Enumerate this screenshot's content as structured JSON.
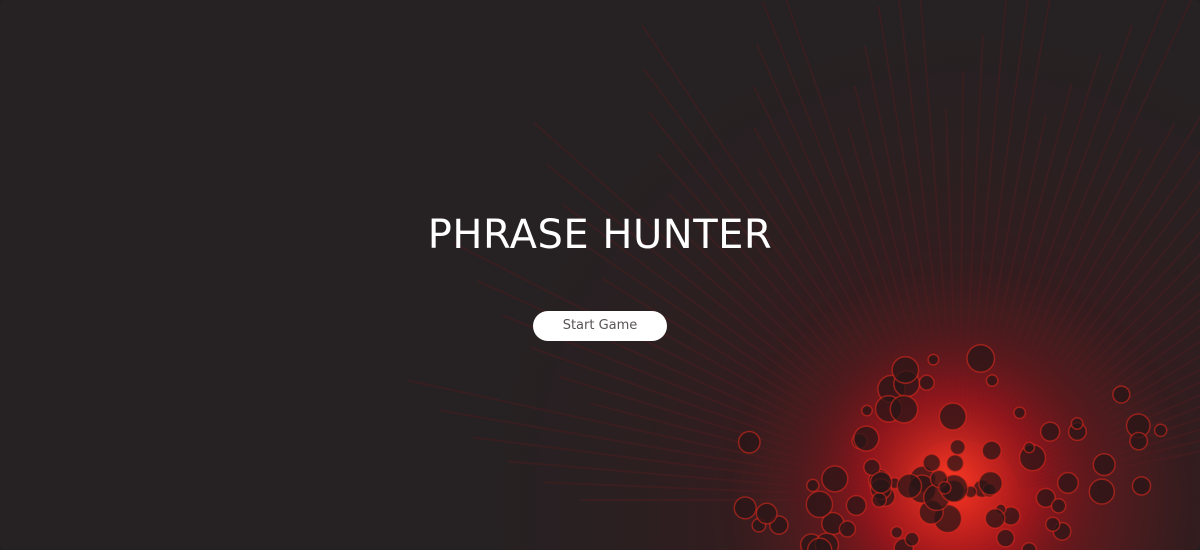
{
  "game": {
    "title": "PHRASE HUNTER",
    "start_button_label": "Start Game"
  },
  "colors": {
    "background": "#262122",
    "accent_glow": "#e0281e",
    "title_text": "#ffffff",
    "button_bg": "#ffffff",
    "button_text": "#5a5456"
  }
}
